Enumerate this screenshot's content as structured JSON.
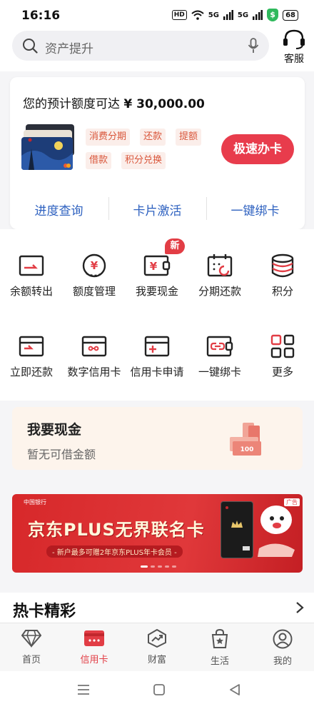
{
  "status_bar": {
    "time": "16:16",
    "hd": "HD",
    "signal_1": "5G",
    "signal_2": "5G",
    "shield": "$",
    "battery": "68"
  },
  "header": {
    "search_placeholder": "资产提升",
    "service_label": "客服"
  },
  "card_panel": {
    "limit_prefix": "您的预计额度可达",
    "limit_amount": "¥ 30,000.00",
    "tags": [
      "消费分期",
      "还款",
      "提额",
      "借款",
      "积分兑换"
    ],
    "apply_button": "极速办卡",
    "links": [
      "进度查询",
      "卡片激活",
      "一键绑卡"
    ]
  },
  "services": {
    "new_badge": "新",
    "row1": [
      {
        "label": "余额转出",
        "icon": "card-transfer-icon"
      },
      {
        "label": "额度管理",
        "icon": "yen-gauge-icon"
      },
      {
        "label": "我要现金",
        "icon": "yen-wallet-icon"
      },
      {
        "label": "分期还款",
        "icon": "calendar-installment-icon"
      },
      {
        "label": "积分",
        "icon": "points-stack-icon"
      }
    ],
    "row2": [
      {
        "label": "立即还款",
        "icon": "card-repay-icon"
      },
      {
        "label": "数字信用卡",
        "icon": "digital-card-icon"
      },
      {
        "label": "信用卡申请",
        "icon": "card-apply-icon"
      },
      {
        "label": "一键绑卡",
        "icon": "card-bind-icon"
      },
      {
        "label": "更多",
        "icon": "more-grid-icon"
      }
    ]
  },
  "cash": {
    "title": "我要现金",
    "subtitle": "暂无可借金额",
    "money_label": "100"
  },
  "banner": {
    "title": "京东PLUS无界联名卡",
    "subtitle": "- 新户最多可赠2年京东PLUS年卡会员 -",
    "ad_label": "广告",
    "logo_text": "中国银行"
  },
  "hot": {
    "title": "热卡精彩"
  },
  "tab_bar": {
    "tabs": [
      {
        "label": "首页",
        "icon": "diamond-icon"
      },
      {
        "label": "信用卡",
        "icon": "credit-card-icon"
      },
      {
        "label": "财富",
        "icon": "trend-chart-icon"
      },
      {
        "label": "生活",
        "icon": "shopping-bag-icon"
      },
      {
        "label": "我的",
        "icon": "person-icon"
      }
    ],
    "active": "信用卡"
  },
  "colors": {
    "accent": "#e83c4c",
    "link": "#2f62c0",
    "tag_bg": "#fbeeea",
    "tag_text": "#d9563b"
  }
}
